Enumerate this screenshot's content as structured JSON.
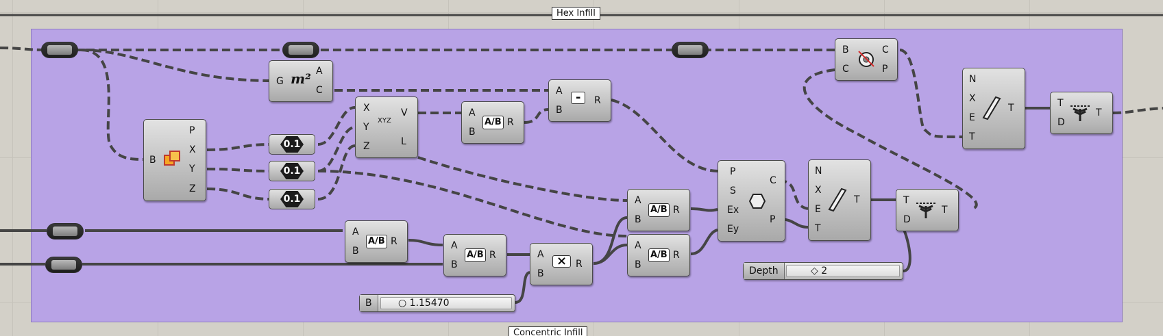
{
  "groups": {
    "hex_infill": "Hex Infill",
    "concentric_infill": "Concentric Infill"
  },
  "components": {
    "area": {
      "icon": "area-icon",
      "inputs": [
        "G"
      ],
      "outputs": [
        "A",
        "C"
      ],
      "symbol": "m²"
    },
    "deconstruct_box": {
      "icon": "box-icon",
      "inputs": [
        "B"
      ],
      "outputs": [
        "P",
        "X",
        "Y",
        "Z"
      ]
    },
    "construct_point": {
      "icon": "xyz-point-icon",
      "inputs": [
        "X",
        "Y",
        "Z"
      ],
      "outputs": [
        "V",
        "L"
      ],
      "symbol": "XYZ"
    },
    "division_top": {
      "icon": "division-icon",
      "inputs": [
        "A",
        "B"
      ],
      "outputs": [
        "R"
      ]
    },
    "subtraction": {
      "icon": "subtraction-icon",
      "inputs": [
        "A",
        "B"
      ],
      "outputs": [
        "R"
      ],
      "symbol": "-"
    },
    "hexagonal_grid": {
      "icon": "hexagon-icon",
      "inputs": [
        "P",
        "S",
        "Ex",
        "Ey"
      ],
      "outputs": [
        "C",
        "P"
      ]
    },
    "prune_tree_mid": {
      "icon": "saw-icon",
      "inputs": [
        "N",
        "X",
        "E",
        "T"
      ],
      "outputs": [
        "T"
      ]
    },
    "trim_tree_mid": {
      "icon": "trim-tree-icon",
      "inputs": [
        "T",
        "D"
      ],
      "outputs": [
        "T"
      ]
    },
    "region_intersection": {
      "icon": "region-icon",
      "inputs": [
        "B",
        "C"
      ],
      "outputs": [
        "C",
        "P"
      ]
    },
    "prune_tree_top": {
      "icon": "saw-icon",
      "inputs": [
        "N",
        "X",
        "E",
        "T"
      ],
      "outputs": [
        "T"
      ]
    },
    "trim_tree_top": {
      "icon": "trim-tree-icon",
      "inputs": [
        "T",
        "D"
      ],
      "outputs": [
        "T"
      ]
    },
    "division_low1": {
      "icon": "division-icon",
      "inputs": [
        "A",
        "B"
      ],
      "outputs": [
        "R"
      ]
    },
    "division_low2": {
      "icon": "division-icon",
      "inputs": [
        "A",
        "B"
      ],
      "outputs": [
        "R"
      ]
    },
    "multiplication": {
      "icon": "multiplication-icon",
      "inputs": [
        "A",
        "B"
      ],
      "outputs": [
        "R"
      ],
      "symbol": "×"
    },
    "division_right1": {
      "icon": "division-icon",
      "inputs": [
        "A",
        "B"
      ],
      "outputs": [
        "R"
      ]
    },
    "division_right2": {
      "icon": "division-icon",
      "inputs": [
        "A",
        "B"
      ],
      "outputs": [
        "R"
      ]
    }
  },
  "numbers": [
    "0.1",
    "0.1",
    "0.1"
  ],
  "division_symbol": "A/B",
  "sliders": {
    "depth": {
      "label": "Depth",
      "value": "◇ 2"
    },
    "b": {
      "label": "B",
      "value": "○ 1.15470"
    }
  },
  "colors": {
    "canvas": "#d3d0c8",
    "group": "#b8a3e6",
    "wire": "#454545"
  }
}
